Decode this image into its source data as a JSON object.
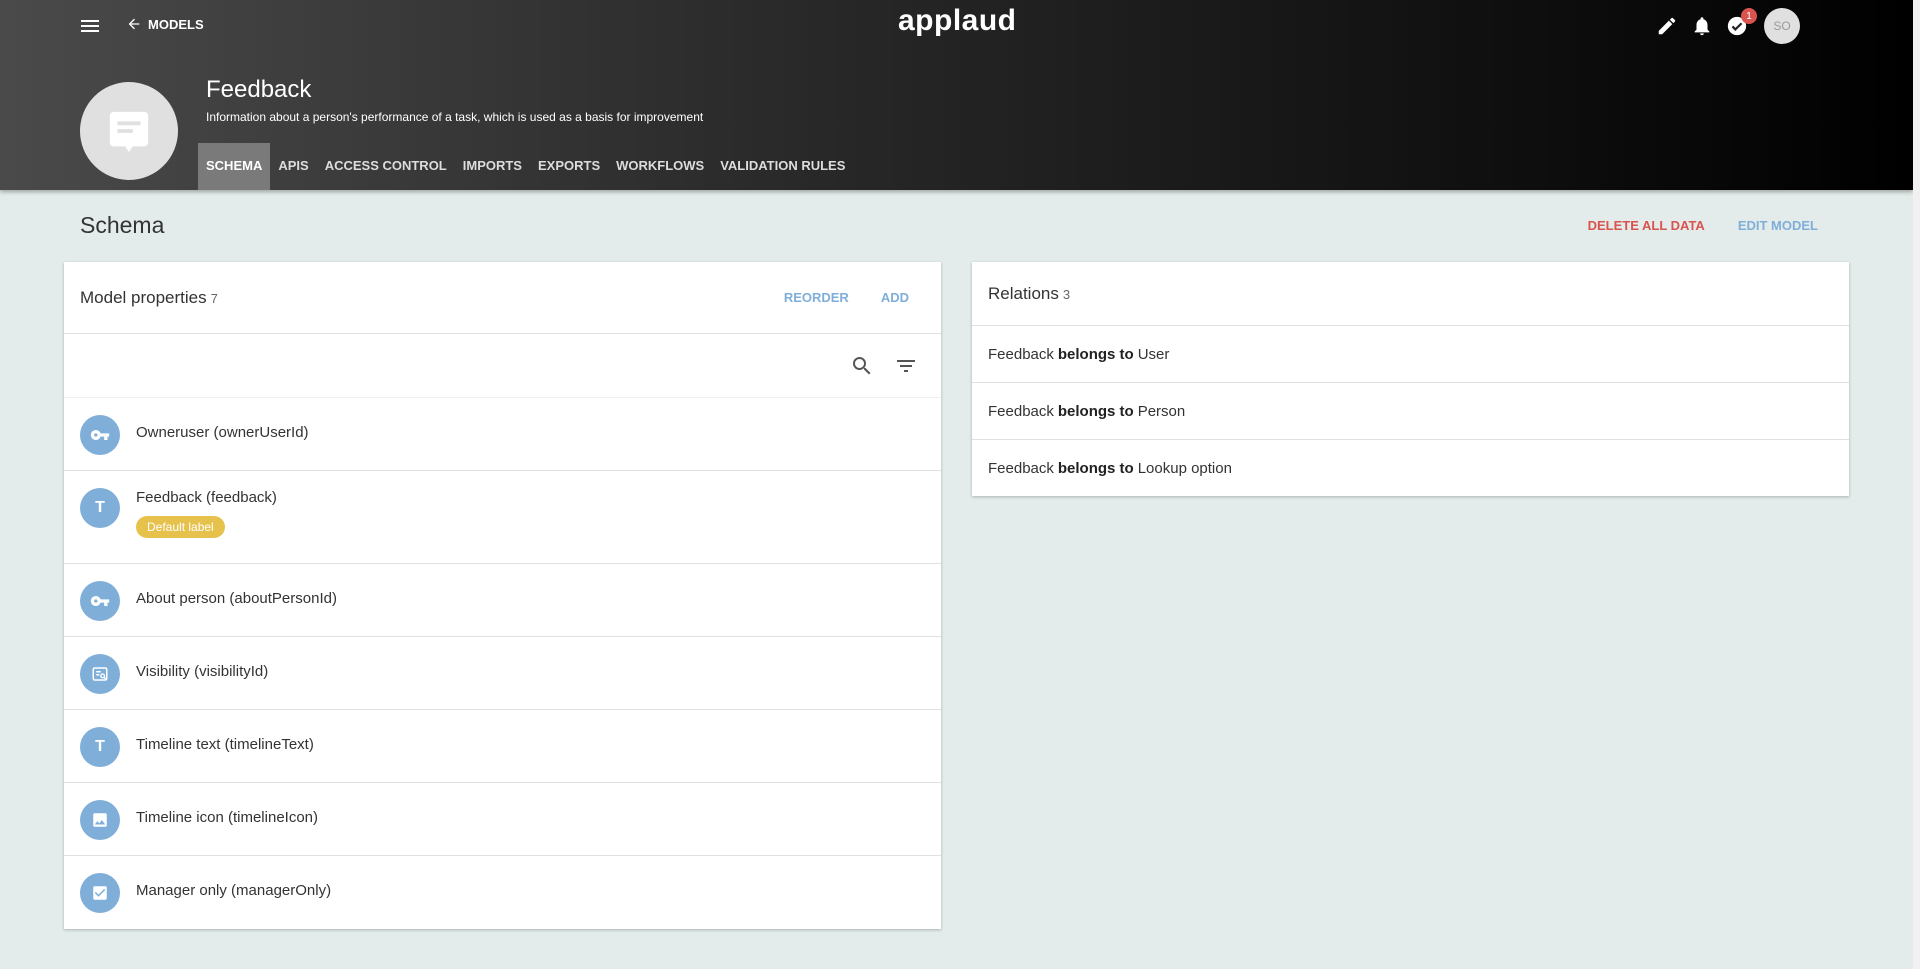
{
  "header": {
    "back_label": "MODELS",
    "logo": "applaud",
    "notification_count": "1",
    "avatar_initials": "SO"
  },
  "model": {
    "title": "Feedback",
    "description": "Information about a person's performance of a task, which is used as a basis for improvement",
    "icon": "feedback-icon"
  },
  "tabs": [
    {
      "label": "SCHEMA",
      "active": true
    },
    {
      "label": "APIS",
      "active": false
    },
    {
      "label": "ACCESS CONTROL",
      "active": false
    },
    {
      "label": "IMPORTS",
      "active": false
    },
    {
      "label": "EXPORTS",
      "active": false
    },
    {
      "label": "WORKFLOWS",
      "active": false
    },
    {
      "label": "VALIDATION RULES",
      "active": false
    }
  ],
  "page": {
    "title": "Schema",
    "delete_label": "DELETE ALL DATA",
    "edit_label": "EDIT MODEL"
  },
  "properties": {
    "title": "Model properties",
    "count": "7",
    "reorder_label": "REORDER",
    "add_label": "ADD",
    "items": [
      {
        "label": "Owneruser (ownerUserId)",
        "icon": "key-icon"
      },
      {
        "label": "Feedback (feedback)",
        "icon": "text-icon",
        "badge": "Default label"
      },
      {
        "label": "About person (aboutPersonId)",
        "icon": "key-icon"
      },
      {
        "label": "Visibility (visibilityId)",
        "icon": "lookup-icon"
      },
      {
        "label": "Timeline text (timelineText)",
        "icon": "text-icon"
      },
      {
        "label": "Timeline icon (timelineIcon)",
        "icon": "image-icon"
      },
      {
        "label": "Manager only (managerOnly)",
        "icon": "checkbox-icon"
      }
    ]
  },
  "relations": {
    "title": "Relations",
    "count": "3",
    "items": [
      {
        "subject": "Feedback",
        "verb": "belongs to",
        "object": "User"
      },
      {
        "subject": "Feedback",
        "verb": "belongs to",
        "object": "Person"
      },
      {
        "subject": "Feedback",
        "verb": "belongs to",
        "object": "Lookup option"
      }
    ]
  },
  "colors": {
    "accent": "#7fafd9",
    "danger": "#d9534f",
    "badge": "#e6c24c",
    "background": "#e3ecea"
  }
}
